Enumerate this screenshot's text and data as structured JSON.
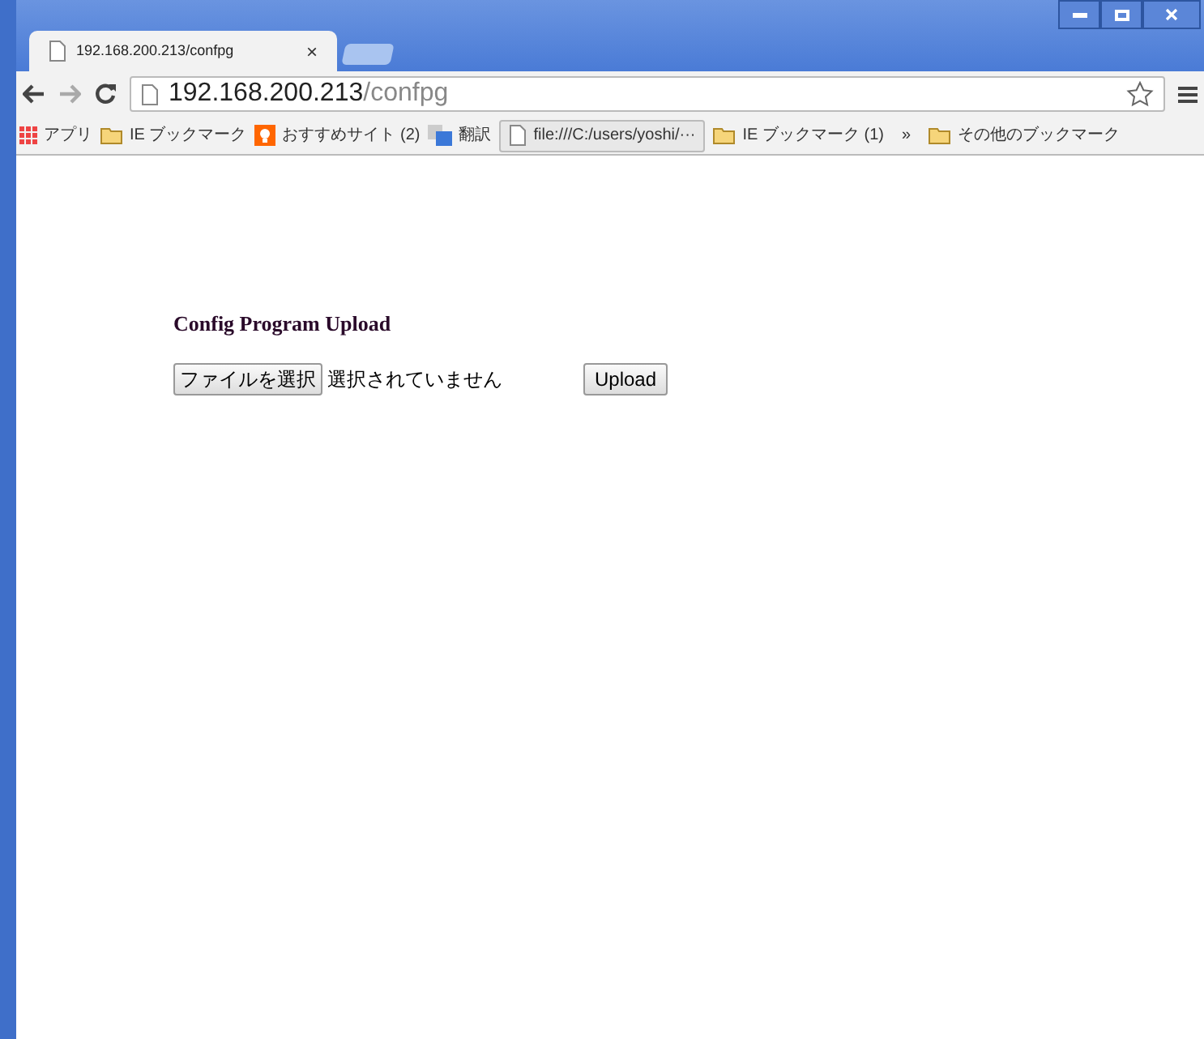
{
  "tab": {
    "title": "192.168.200.213/confpg",
    "close": "×"
  },
  "address": {
    "host": "192.168.200.213",
    "path": "/confpg"
  },
  "bookmarks": [
    {
      "kind": "apps",
      "label": "アプリ"
    },
    {
      "kind": "folder",
      "label": "IE ブックマーク"
    },
    {
      "kind": "bulb",
      "label": "おすすめサイト (2)"
    },
    {
      "kind": "translate",
      "label": "翻訳"
    },
    {
      "kind": "page",
      "label": "file:///C:/users/yoshi/···"
    },
    {
      "kind": "folder",
      "label": "IE ブックマーク (1)"
    },
    {
      "kind": "more",
      "label": "»"
    },
    {
      "kind": "folder",
      "label": "その他のブックマーク"
    }
  ],
  "page": {
    "heading": "Config Program Upload",
    "file_button": "ファイルを選択",
    "file_status": "選択されていません",
    "upload_button": "Upload"
  }
}
